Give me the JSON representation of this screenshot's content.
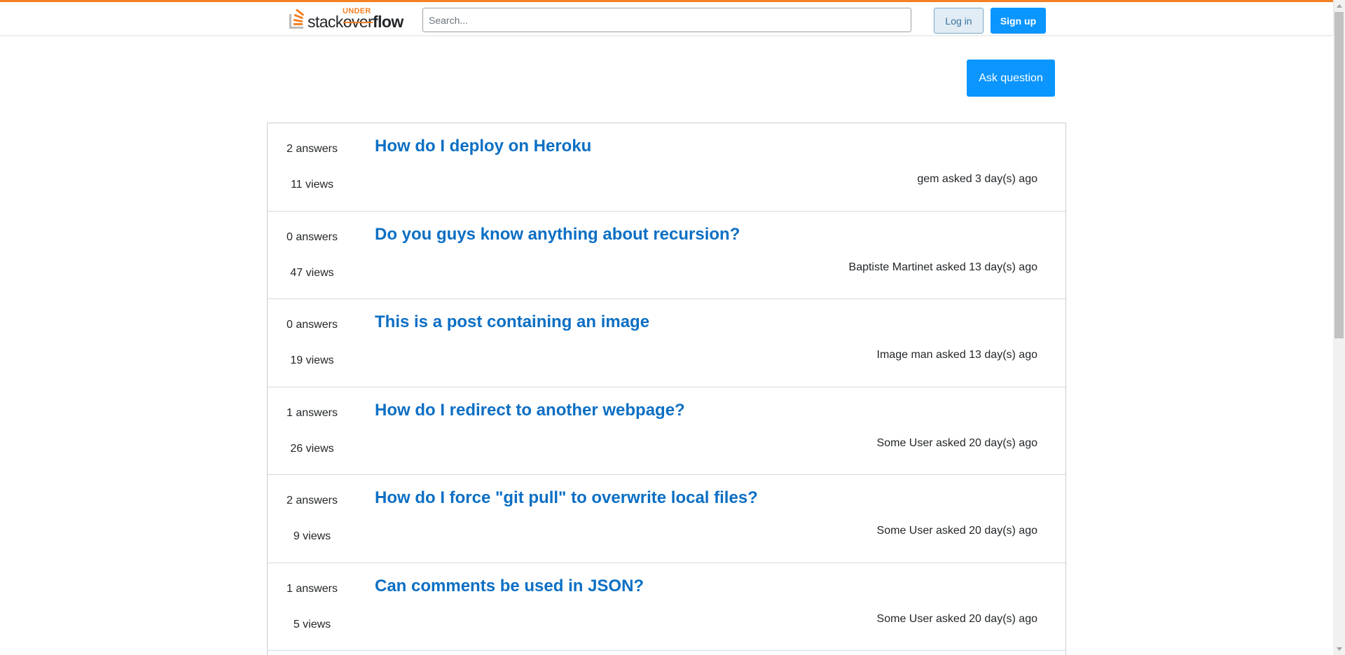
{
  "header": {
    "logo": {
      "stack": "stack",
      "over": "over",
      "flow": "flow",
      "under": "UNDER"
    },
    "search_placeholder": "Search...",
    "search_value": "",
    "login_label": "Log in",
    "signup_label": "Sign up"
  },
  "main": {
    "ask_label": "Ask question",
    "questions": [
      {
        "answers": "2 answers",
        "views": "11 views",
        "title": "How do I deploy on Heroku",
        "meta": "gem asked 3 day(s) ago"
      },
      {
        "answers": "0 answers",
        "views": "47 views",
        "title": "Do you guys know anything about recursion?",
        "meta": "Baptiste Martinet asked 13 day(s) ago"
      },
      {
        "answers": "0 answers",
        "views": "19 views",
        "title": "This is a post containing an image",
        "meta": "Image man asked 13 day(s) ago"
      },
      {
        "answers": "1 answers",
        "views": "26 views",
        "title": "How do I redirect to another webpage?",
        "meta": "Some User asked 20 day(s) ago"
      },
      {
        "answers": "2 answers",
        "views": "9 views",
        "title": "How do I force \"git pull\" to overwrite local files?",
        "meta": "Some User asked 20 day(s) ago"
      },
      {
        "answers": "1 answers",
        "views": "5 views",
        "title": "Can comments be used in JSON?",
        "meta": "Some User asked 20 day(s) ago"
      }
    ]
  },
  "colors": {
    "accent_orange": "#f48024",
    "primary_blue": "#0a95ff",
    "link_blue": "#0c6fc4",
    "login_bg": "#e1ecf4"
  },
  "icons": {
    "logo": "stack-logo-icon",
    "scroll_up": "chevron-up-icon",
    "scroll_down": "chevron-down-icon"
  }
}
